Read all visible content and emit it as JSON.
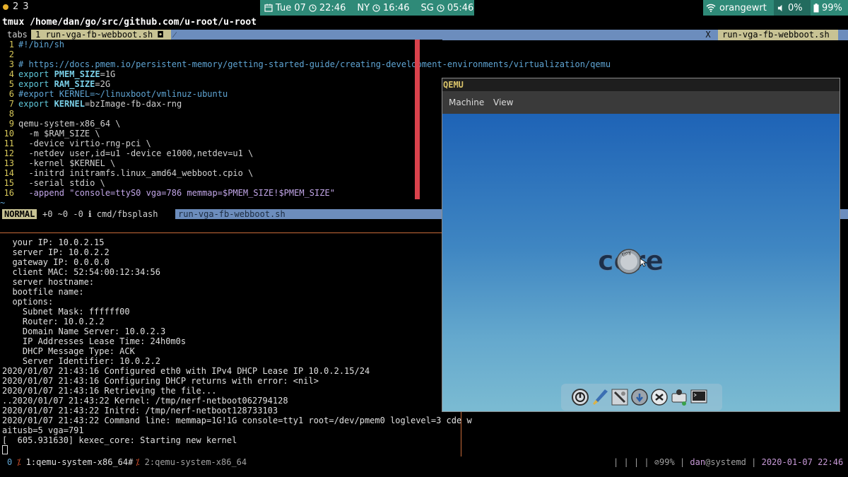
{
  "topbar": {
    "workspaces": [
      "2",
      "3"
    ],
    "date": "Tue 07",
    "time_local": "22:46",
    "tz1_label": "NY",
    "tz1_time": "16:46",
    "tz2_label": "SG",
    "tz2_time": "05:46",
    "network": "orangewrt",
    "volume": "0%",
    "battery": "99%"
  },
  "window_title": "tmux /home/dan/go/src/github.com/u-root/u-root",
  "tabline": {
    "label": "tabs",
    "active_tab": "1 run-vga-fb-webboot.sh",
    "close": "X",
    "right_tab": "run-vga-fb-webboot.sh"
  },
  "editor": {
    "lines": [
      {
        "n": "1",
        "text": "#!/bin/sh"
      },
      {
        "n": "2",
        "text": ""
      },
      {
        "n": "3",
        "text": "# https://docs.pmem.io/persistent-memory/getting-started-guide/creating-development-environments/virtualization/qemu"
      },
      {
        "n": "4",
        "kw": "export ",
        "var": "PMEM_SIZE",
        "rest": "=1G"
      },
      {
        "n": "5",
        "kw": "export ",
        "var": "RAM_SIZE",
        "rest": "=2G"
      },
      {
        "n": "6",
        "text": "#export KERNEL=~/linuxboot/vmlinuz-ubuntu"
      },
      {
        "n": "7",
        "kw": "export ",
        "var": "KERNEL",
        "rest": "=bzImage-fb-dax-rng"
      },
      {
        "n": "8",
        "text": ""
      },
      {
        "n": "9",
        "text": "qemu-system-x86_64 \\"
      },
      {
        "n": "10",
        "text": "  -m $RAM_SIZE \\"
      },
      {
        "n": "11",
        "text": "  -device virtio-rng-pci \\"
      },
      {
        "n": "12",
        "text": "  -netdev user,id=u1 -device e1000,netdev=u1 \\"
      },
      {
        "n": "13",
        "text": "  -kernel $KERNEL \\"
      },
      {
        "n": "14",
        "text": "  -initrd initramfs.linux_amd64_webboot.cpio \\"
      },
      {
        "n": "15",
        "text": "  -serial stdio \\"
      },
      {
        "n": "16",
        "text": "  -append \"console=ttyS0 vga=786 memmap=$PMEM_SIZE!$PMEM_SIZE\""
      }
    ],
    "tilde": "~"
  },
  "statusline": {
    "mode": "NORMAL",
    "info": "+0 ~0 -0 ℹ cmd/fbsplash",
    "filename": "run-vga-fb-webboot.sh"
  },
  "terminal": {
    "lines": [
      "  your IP: 10.0.2.15",
      "  server IP: 10.0.2.2",
      "  gateway IP: 0.0.0.0",
      "  client MAC: 52:54:00:12:34:56",
      "  server hostname:",
      "  bootfile name:",
      "  options:",
      "    Subnet Mask: ffffff00",
      "    Router: 10.0.2.2",
      "    Domain Name Server: 10.0.2.3",
      "    IP Addresses Lease Time: 24h0m0s",
      "    DHCP Message Type: ACK",
      "    Server Identifier: 10.0.2.2",
      "2020/01/07 21:43:16 Configured eth0 with IPv4 DHCP Lease IP 10.0.2.15/24",
      "2020/01/07 21:43:16 Configuring DHCP returns with error: <nil>",
      "2020/01/07 21:43:16 Retrieving the file...",
      "..2020/01/07 21:43:22 Kernel: /tmp/nerf-netboot062794128",
      "2020/01/07 21:43:22 Initrd: /tmp/nerf-netboot128733103",
      "2020/01/07 21:43:22 Command line: memmap=1G!1G console=tty1 root=/dev/pmem0 loglevel=3 cde w",
      "aitusb=5 vga=791",
      "[  605.931630] kexec_core: Starting new kernel"
    ]
  },
  "tmuxbar": {
    "session": "0",
    "win1": "1:qemu-system-x86_64#",
    "win2": "2:qemu-system-x86_64",
    "right_seps": "|  |  |",
    "battery": "99%",
    "user": "dan",
    "host": "@systemd",
    "datetime": "2020-01-07 22:46"
  },
  "qemu": {
    "title": "QEMU",
    "menu": [
      "Machine",
      "View"
    ],
    "logo_text": "core",
    "logo_small": "tiny"
  }
}
